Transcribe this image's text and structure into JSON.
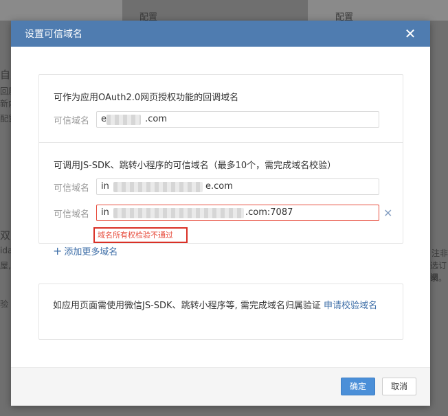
{
  "background": {
    "top_left_label": "配置",
    "top_right_label": "配置",
    "fragments": [
      "自定",
      "回展",
      "新内",
      "配置",
      "双方",
      "ida",
      "屋,",
      "验",
      "注非",
      "选订阅",
      "录。"
    ]
  },
  "modal": {
    "title": "设置可信域名",
    "close_icon": "close-icon",
    "oauth_section": {
      "title": "可作为应用OAuth2.0网页授权功能的回调域名",
      "label": "可信域名",
      "value_prefix": "e",
      "value_suffix": ".com"
    },
    "jssdk_section": {
      "title": "可调用JS-SDK、跳转小程序的可信域名（最多10个，需完成域名校验）",
      "rows": [
        {
          "label": "可信域名",
          "value_prefix": "in",
          "value_suffix": "e.com"
        },
        {
          "label": "可信域名",
          "value_prefix": "in",
          "value_suffix": ".com:7087"
        }
      ],
      "error_text": "域名所有权检验不通过",
      "add_more": "添加更多域名"
    },
    "notice": {
      "text": "如应用页面需使用微信JS-SDK、跳转小程序等, 需完成域名归属验证",
      "link": "申请校验域名"
    },
    "footer": {
      "ok": "确定",
      "cancel": "取消"
    }
  },
  "colors": {
    "header": "#4f7cb0",
    "link": "#3f6fa8",
    "error": "#e74c3c",
    "primary_button": "#4b8fd8"
  }
}
